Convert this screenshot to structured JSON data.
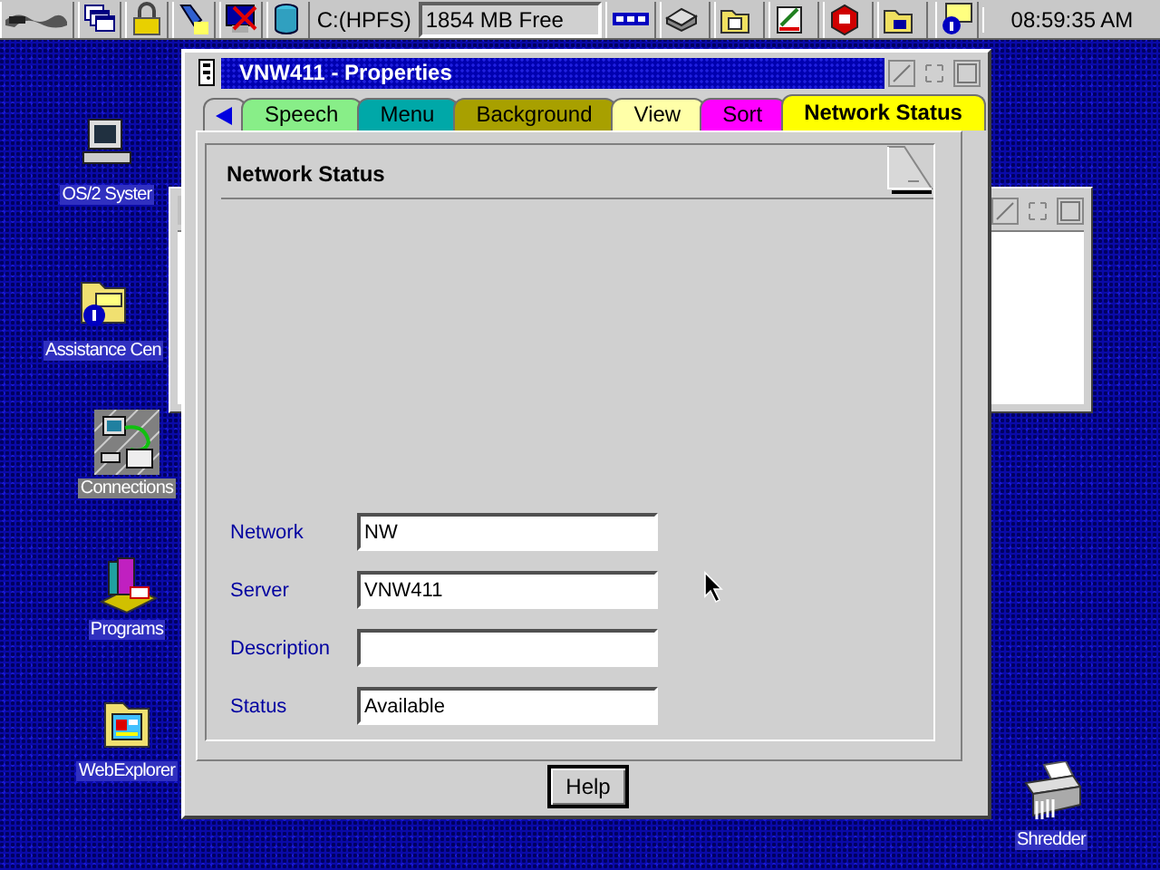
{
  "taskbar": {
    "drive": "C:(HPFS)",
    "free_space": "1854 MB Free",
    "clock": "08:59:35 AM"
  },
  "desktop_icons": [
    {
      "kind": "computer",
      "label": "OS/2 Syster",
      "selected": false
    },
    {
      "kind": "info-folder",
      "label": "Assistance Cen",
      "selected": false
    },
    {
      "kind": "network",
      "label": "Connections",
      "selected": true
    },
    {
      "kind": "programs",
      "label": "Programs",
      "selected": false
    },
    {
      "kind": "web-folder",
      "label": "WebExplorer",
      "selected": false
    },
    {
      "kind": "shredder",
      "label": "Shredder",
      "selected": false
    }
  ],
  "window": {
    "title": "VNW411 - Properties",
    "tabs": [
      {
        "label": "Speech",
        "color": "#88ee88",
        "selected": false
      },
      {
        "label": "Menu",
        "color": "#00a8a8",
        "selected": false
      },
      {
        "label": "Background",
        "color": "#a8a000",
        "selected": false
      },
      {
        "label": "View",
        "color": "#ffffa8",
        "selected": false
      },
      {
        "label": "Sort",
        "color": "#ff00ff",
        "selected": false
      },
      {
        "label": "Network Status",
        "color": "#ffff00",
        "selected": true
      }
    ],
    "page": {
      "title": "Network Status",
      "fields": [
        {
          "label": "Network",
          "value": "NW"
        },
        {
          "label": "Server",
          "value": "VNW411"
        },
        {
          "label": "Description"
        },
        {
          "label": "Status",
          "value": "Available"
        }
      ]
    },
    "buttons": [
      "Help"
    ]
  }
}
